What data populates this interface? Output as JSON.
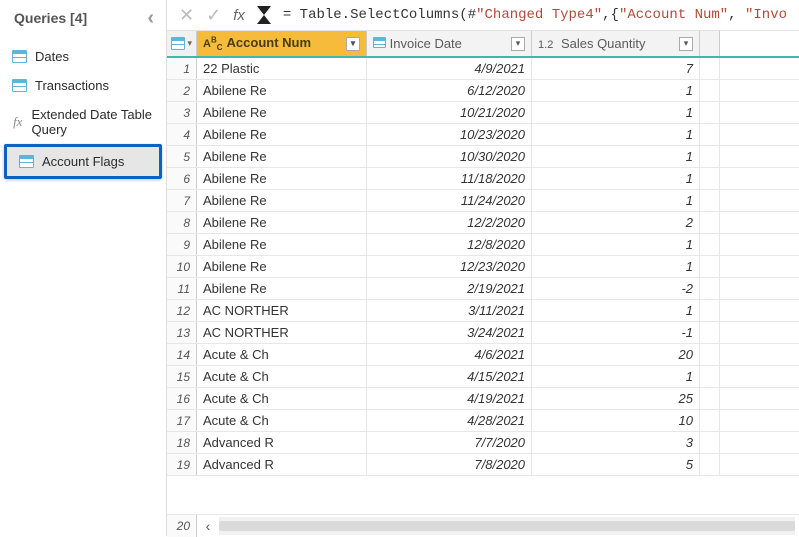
{
  "sidebar": {
    "title": "Queries [4]",
    "items": [
      {
        "label": "Dates",
        "icon": "table"
      },
      {
        "label": "Transactions",
        "icon": "table"
      },
      {
        "label": "Extended Date Table Query",
        "icon": "fx"
      },
      {
        "label": "Account Flags",
        "icon": "table",
        "selected": true,
        "highlighted": true
      }
    ]
  },
  "formula_bar": {
    "prefix": "= Table.SelectColumns(#",
    "str1": "\"Changed Type4\"",
    "mid": ",{",
    "str2": "\"Account Num\"",
    "sep": ", ",
    "str3": "\"Invo"
  },
  "columns": [
    {
      "type_label": "ABC",
      "name": "Account Num",
      "selected": true
    },
    {
      "type_label": "date",
      "name": "Invoice Date"
    },
    {
      "type_label": "1.2",
      "name": "Sales Quantity"
    }
  ],
  "rows": [
    {
      "acct": "22 Plastic",
      "date": "4/9/2021",
      "qty": "7"
    },
    {
      "acct": "Abilene Re",
      "date": "6/12/2020",
      "qty": "1"
    },
    {
      "acct": "Abilene Re",
      "date": "10/21/2020",
      "qty": "1"
    },
    {
      "acct": "Abilene Re",
      "date": "10/23/2020",
      "qty": "1"
    },
    {
      "acct": "Abilene Re",
      "date": "10/30/2020",
      "qty": "1"
    },
    {
      "acct": "Abilene Re",
      "date": "11/18/2020",
      "qty": "1"
    },
    {
      "acct": "Abilene Re",
      "date": "11/24/2020",
      "qty": "1"
    },
    {
      "acct": "Abilene Re",
      "date": "12/2/2020",
      "qty": "2"
    },
    {
      "acct": "Abilene Re",
      "date": "12/8/2020",
      "qty": "1"
    },
    {
      "acct": "Abilene Re",
      "date": "12/23/2020",
      "qty": "1"
    },
    {
      "acct": "Abilene Re",
      "date": "2/19/2021",
      "qty": "-2"
    },
    {
      "acct": "AC NORTHER",
      "date": "3/11/2021",
      "qty": "1"
    },
    {
      "acct": "AC NORTHER",
      "date": "3/24/2021",
      "qty": "-1"
    },
    {
      "acct": "Acute & Ch",
      "date": "4/6/2021",
      "qty": "20"
    },
    {
      "acct": "Acute & Ch",
      "date": "4/15/2021",
      "qty": "1"
    },
    {
      "acct": "Acute & Ch",
      "date": "4/19/2021",
      "qty": "25"
    },
    {
      "acct": "Acute & Ch",
      "date": "4/28/2021",
      "qty": "10"
    },
    {
      "acct": "Advanced R",
      "date": "7/7/2020",
      "qty": "3"
    },
    {
      "acct": "Advanced R",
      "date": "7/8/2020",
      "qty": "5"
    }
  ],
  "next_row_number": "20"
}
